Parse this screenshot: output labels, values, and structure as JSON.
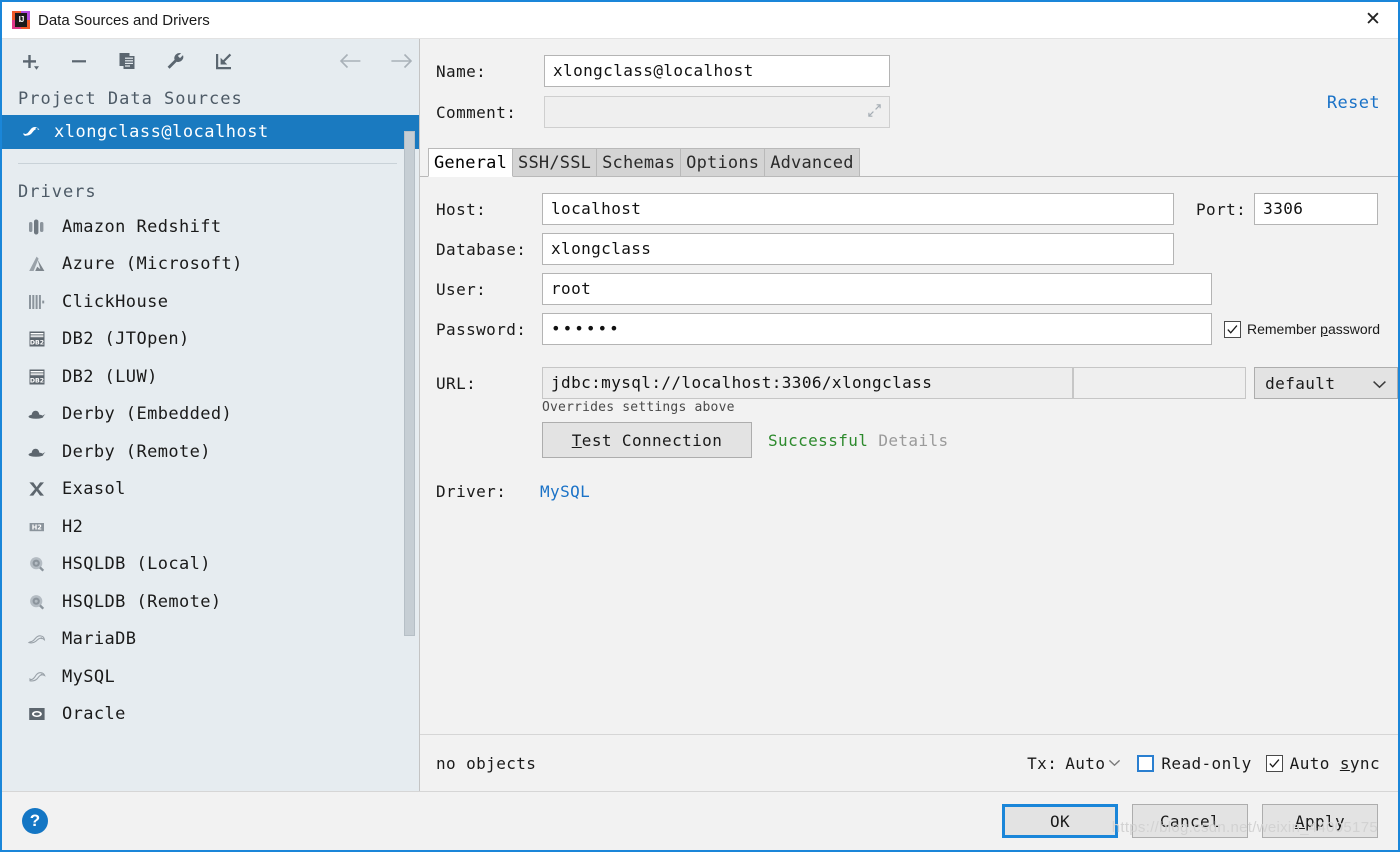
{
  "window": {
    "title": "Data Sources and Drivers",
    "close_label": "✕",
    "app_icon": "intellij-idea-icon"
  },
  "toolbar": {
    "buttons": [
      {
        "name": "add-button",
        "icon": "plus-icon"
      },
      {
        "name": "remove-button",
        "icon": "minus-icon"
      },
      {
        "name": "duplicate-button",
        "icon": "copy-icon"
      },
      {
        "name": "properties-button",
        "icon": "wrench-icon"
      },
      {
        "name": "import-button",
        "icon": "import-arrow-icon"
      }
    ],
    "back_icon": "arrow-left-icon",
    "forward_icon": "arrow-right-icon"
  },
  "sidebar": {
    "project_section_title": "Project Data Sources",
    "data_sources": [
      {
        "label": "xlongclass@localhost",
        "icon": "mysql-dolphin-icon",
        "selected": true
      }
    ],
    "drivers_section_title": "Drivers",
    "drivers": [
      {
        "label": "Amazon Redshift",
        "icon": "redshift-icon"
      },
      {
        "label": "Azure (Microsoft)",
        "icon": "azure-icon"
      },
      {
        "label": "ClickHouse",
        "icon": "clickhouse-icon"
      },
      {
        "label": "DB2 (JTOpen)",
        "icon": "db2-icon"
      },
      {
        "label": "DB2 (LUW)",
        "icon": "db2-icon"
      },
      {
        "label": "Derby (Embedded)",
        "icon": "derby-hat-icon"
      },
      {
        "label": "Derby (Remote)",
        "icon": "derby-hat-icon"
      },
      {
        "label": "Exasol",
        "icon": "exasol-x-icon"
      },
      {
        "label": "H2",
        "icon": "h2-icon"
      },
      {
        "label": "HSQLDB (Local)",
        "icon": "hsqldb-icon"
      },
      {
        "label": "HSQLDB (Remote)",
        "icon": "hsqldb-icon"
      },
      {
        "label": "MariaDB",
        "icon": "mariadb-seal-icon"
      },
      {
        "label": "MySQL",
        "icon": "mysql-dolphin-icon"
      },
      {
        "label": "Oracle",
        "icon": "oracle-icon"
      }
    ]
  },
  "header": {
    "name_label": "Name:",
    "name_value": "xlongclass@localhost",
    "comment_label": "Comment:",
    "comment_value": "",
    "comment_expand_icon": "expand-icon",
    "reset_label": "Reset"
  },
  "tabs": [
    {
      "label": "General",
      "active": true
    },
    {
      "label": "SSH/SSL",
      "active": false
    },
    {
      "label": "Schemas",
      "active": false
    },
    {
      "label": "Options",
      "active": false
    },
    {
      "label": "Advanced",
      "active": false
    }
  ],
  "general": {
    "host_label": "Host:",
    "host_value": "localhost",
    "port_label": "Port:",
    "port_value": "3306",
    "database_label": "Database:",
    "database_value": "xlongclass",
    "user_label": "User:",
    "user_value": "root",
    "password_label": "Password:",
    "password_value": "••••••",
    "remember_password_pre": "Remember ",
    "remember_password_mnemonic": "p",
    "remember_password_post": "assword",
    "remember_password_checked": true,
    "url_label": "URL:",
    "url_value": "jdbc:mysql://localhost:3306/xlongclass",
    "url_hint": "Overrides settings above",
    "url_mode_value": "default",
    "url_mode_caret": "⌄",
    "test_connection_mnemonic": "T",
    "test_connection_rest": "est Connection",
    "test_result": "Successful",
    "test_details": "Details",
    "driver_label": "Driver:",
    "driver_value": "MySQL"
  },
  "status": {
    "objects_text": "no objects",
    "tx_label": "Tx:",
    "tx_value": "Auto",
    "tx_caret": "⌄",
    "readonly_label": "Read-only",
    "readonly_checked": false,
    "autosync_pre": "Auto ",
    "autosync_mnemonic": "s",
    "autosync_post": "ync",
    "autosync_checked": true
  },
  "footer": {
    "help_label": "?",
    "ok_label": "OK",
    "cancel_label": "Cancel",
    "apply_mnemonic": "A",
    "apply_rest": "pply",
    "watermark": "https://blog.csdn.net/weixin_44005175"
  },
  "colors": {
    "accent": "#1a86d9",
    "selection": "#1a7ac0",
    "link": "#1a72c7",
    "success": "#2d8a2d",
    "sidebar_bg": "#e6ecf0"
  }
}
